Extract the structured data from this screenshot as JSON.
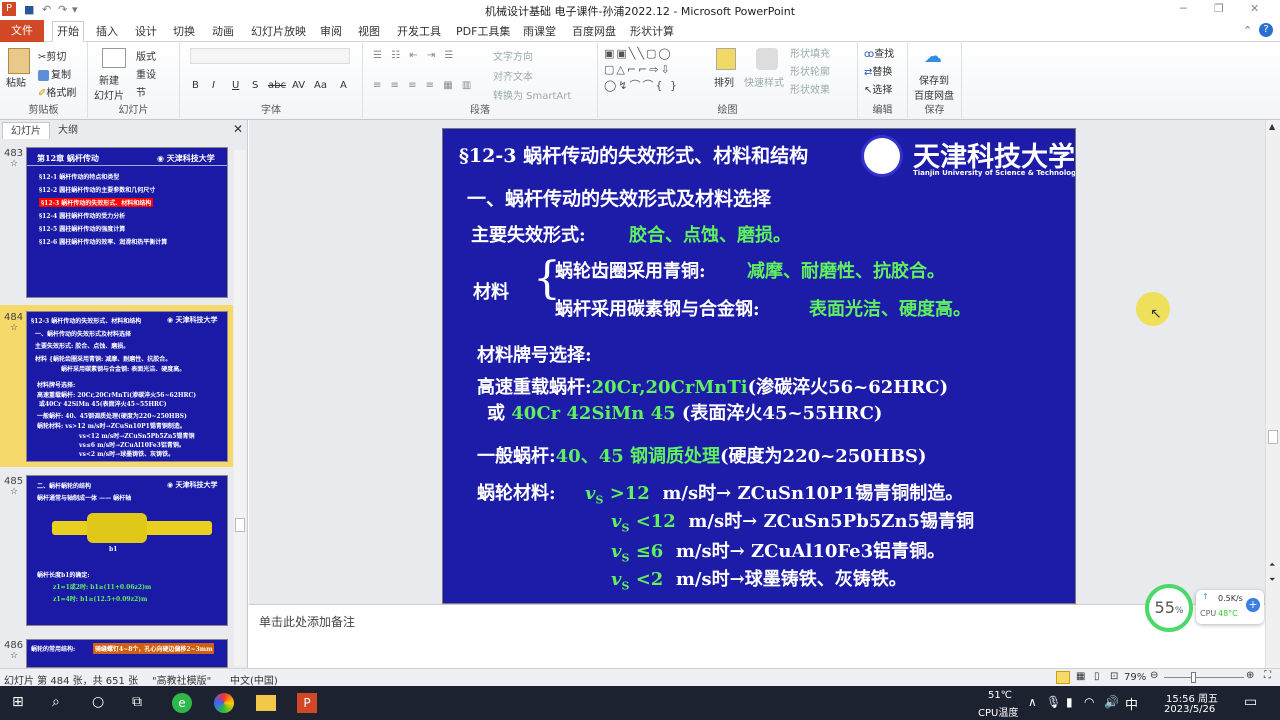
{
  "window": {
    "title": "机械设计基础 电子课件-孙浦2022.12 - Microsoft PowerPoint",
    "app_icon": "P"
  },
  "ribbon_tabs": [
    "文件",
    "开始",
    "插入",
    "设计",
    "切换",
    "动画",
    "幻灯片放映",
    "审阅",
    "视图",
    "开发工具",
    "PDF工具集",
    "雨课堂",
    "百度网盘",
    "形状计算"
  ],
  "ribbon": {
    "clipboard": {
      "label": "剪贴板",
      "paste": "粘贴",
      "cut": "剪切",
      "copy": "复制",
      "format_painter": "格式刷"
    },
    "slides": {
      "label": "幻灯片",
      "new_slide": "新建\n幻灯片",
      "layout": "版式",
      "reset": "重设",
      "section": "节"
    },
    "font": {
      "label": "字体",
      "buttons": [
        "B",
        "I",
        "U",
        "S",
        "abc",
        "AV",
        "Aa",
        "A"
      ]
    },
    "paragraph": {
      "label": "段落",
      "text_direction": "文字方向",
      "align_text": "对齐文本",
      "smartart": "转换为 SmartArt"
    },
    "drawing": {
      "label": "绘图",
      "arrange": "排列",
      "quick_styles": "快速样式",
      "shape_fill": "形状填充",
      "shape_outline": "形状轮廓",
      "shape_effects": "形状效果"
    },
    "editing": {
      "label": "编辑",
      "find": "查找",
      "replace": "替换",
      "select": "选择"
    },
    "save": {
      "label": "保存",
      "save_baidu": "保存到\n百度网盘"
    }
  },
  "panel": {
    "tabs": [
      "幻灯片",
      "大纲"
    ],
    "thumbs": [
      {
        "num": "483",
        "lines": [
          "第12章  蜗杆传动",
          "§12-1  蜗杆传动的特点和类型",
          "§12-2  圆柱蜗杆传动的主要参数和几何尺寸",
          "§12-3  蜗杆传动的失效形式、材料和结构",
          "§12-4  圆柱蜗杆传动的受力分析",
          "§12-5  圆柱蜗杆传动的强度计算",
          "§12-6  圆柱蜗杆传动的效率、润滑和热平衡计算"
        ]
      },
      {
        "num": "484",
        "lines": [
          "§12-3  蜗杆传动的失效形式、材料和结构",
          "一、蜗杆传动的失效形式及材料选择",
          "主要失效形式:  胶合、点蚀、磨损。",
          "材料 {蜗轮齿圈采用青铜: 减摩、耐磨性、抗胶合。",
          "蜗杆采用碳素钢与合金钢: 表面光洁、硬度高。",
          "材料牌号选择:",
          "高速重载蜗杆: 20Cr,20CrMnTi(渗碳淬火56~62HRC)",
          "或40Cr 42SiMn 45(表面淬火45~55HRC)",
          "一般蜗杆: 40、45钢调质处理(硬度为220~250HBS)",
          "蜗轮材料: vs>12 m/s时→ZCuSn10P1锡青铜制造。",
          "vs<12 m/s时→ZCuSn5Pb5Zn5锡青铜",
          "vs≤6 m/s时→ZCuAl10Fe3铝青铜。",
          "vs<2 m/s时→球墨铸铁、灰铸铁。"
        ]
      },
      {
        "num": "485",
        "lines": [
          "二、蜗杆蜗轮的结构",
          "蜗杆通常与轴制成一体 —— 蜗杆轴",
          "b1",
          "蜗杆长度b1的确定:",
          "z1=1或2时: b1≥(11+0.06z2)m",
          "z1=4时: b1≥(12.5+0.09z2)m"
        ]
      },
      {
        "num": "486",
        "lines": [
          "蜗轮的常用结构:",
          "骑缝螺钉4~8个，孔心向硬边偏移2~3mm"
        ]
      }
    ]
  },
  "slide": {
    "title": "§12-3  蜗杆传动的失效形式、材料和结构",
    "logo_cn": "天津科技大学",
    "logo_en": "Tianjin University of Science & Technology",
    "heading": "一、蜗杆传动的失效形式及材料选择",
    "failure_label": "主要失效形式:",
    "failure_value": "胶合、点蚀、磨损。",
    "material_label": "材料",
    "m1_label": "蜗轮齿圈采用青铜:",
    "m1_value": "减摩、耐磨性、抗胶合。",
    "m2_label": "蜗杆采用碳素钢与合金钢:",
    "m2_value": "表面光洁、硬度高。",
    "grade_title": "材料牌号选择:",
    "hs_label": "高速重载蜗杆:",
    "hs_green": "20Cr,20CrMnTi",
    "hs_rest": "(渗碳淬火56~62HRC)",
    "or_label": "或",
    "or_green": "40Cr  42SiMn  45",
    "or_rest": "(表面淬火45~55HRC)",
    "gen_label": "一般蜗杆:",
    "gen_green": "40、45 钢调质处理",
    "gen_rest": "(硬度为220~250HBS)",
    "wheel_label": "蜗轮材料:",
    "wheel_rows": [
      {
        "v": "v",
        "s": "S",
        "cond": ">12",
        "rest": "m/s时→ ZCuSn10P1锡青铜制造。"
      },
      {
        "v": "v",
        "s": "S",
        "cond": "<12",
        "rest": "m/s时→ ZCuSn5Pb5Zn5锡青铜"
      },
      {
        "v": "v",
        "s": "S",
        "cond": "≤6",
        "rest": "m/s时→ ZCuAl10Fe3铝青铜。"
      },
      {
        "v": "v",
        "s": "S",
        "cond": "<2",
        "rest": "m/s时→球墨铸铁、灰铸铁。"
      }
    ]
  },
  "notes_placeholder": "单击此处添加备注",
  "status": {
    "slide_info": "幻灯片 第 484 张，共 651 张",
    "theme": "\"高教社模版\"",
    "language": "中文(中国)",
    "zoom": "79%",
    "zoom_percent": 79
  },
  "widget": {
    "cpu_load": "55",
    "unit": "%",
    "net": "0.5K/s",
    "cpu_temp_label": "CPU",
    "cpu_temp": "48°C"
  },
  "taskbar": {
    "temp": "51℃",
    "temp_label": "CPU温度",
    "ime": "中",
    "time": "15:56 周五",
    "date": "2023/5/26"
  },
  "colors": {
    "slide_bg": "#1c1ca8",
    "green": "#5ff05f",
    "file_tab": "#d24726",
    "highlight": "#ff0000"
  }
}
